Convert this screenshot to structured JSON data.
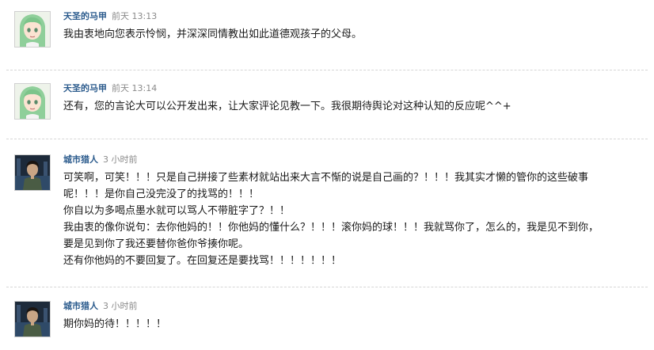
{
  "comments": [
    {
      "author": "天圣的马甲",
      "time": "前天 13:13",
      "avatar_icon": "anime-girl-green-hair-avatar",
      "lines": [
        "我由衷地向您表示怜悯，并深深同情教出如此道德观孩子的父母。"
      ]
    },
    {
      "author": "天圣的马甲",
      "time": "前天 13:14",
      "avatar_icon": "anime-girl-green-hair-avatar",
      "lines": [
        "还有，您的言论大可以公开发出来，让大家评论见教一下。我很期待舆论对这种认知的反应呢^^+"
      ]
    },
    {
      "author": "城市猎人",
      "time": "3 小时前",
      "avatar_icon": "city-hunter-avatar",
      "lines": [
        "可笑啊，可笑！！！只是自己拼接了些素材就站出来大言不惭的说是自己画的？！！！我其实才懒的管你的这些破事",
        "呢！！！是你自己没完没了的找骂的！！！",
        "你自以为多喝点墨水就可以骂人不带脏字了？！！",
        "我由衷的像你说句：去你他妈的！！你他妈的懂什么？！！！滚你妈的球！！！我就骂你了，怎么的，我是见不到你，",
        "要是见到你了我还要替你爸你爷揍你呢。",
        "还有你他妈的不要回复了。在回复还是要找骂！！！！！！！"
      ]
    },
    {
      "author": "城市猎人",
      "time": "3 小时前",
      "avatar_icon": "city-hunter-avatar",
      "lines": [
        "期你妈的待！！！！！"
      ]
    }
  ],
  "colors": {
    "author": "#2a5a8c",
    "time": "#8a8a8a",
    "text": "#1a1a1a",
    "divider": "#d6d6d6"
  }
}
